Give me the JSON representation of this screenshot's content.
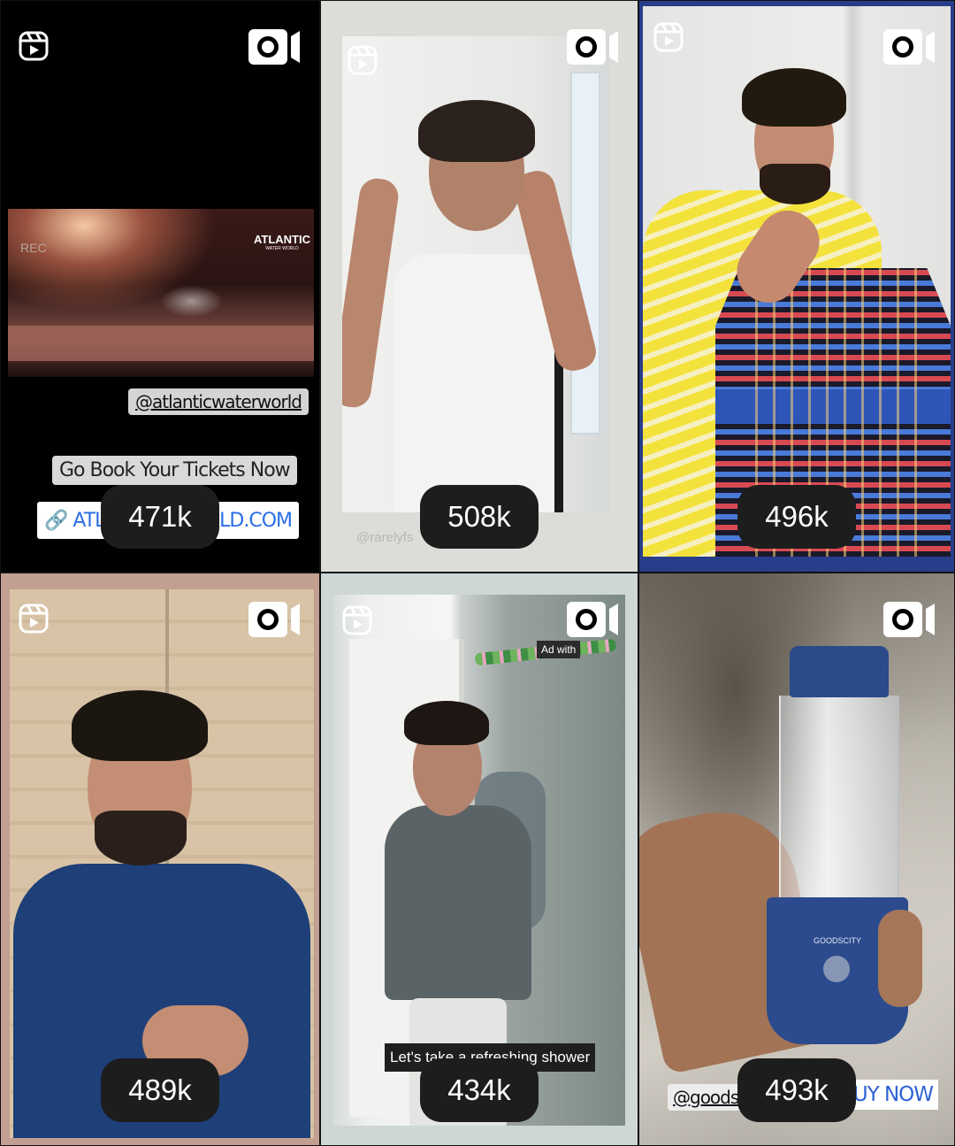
{
  "grid": {
    "tiles": [
      {
        "views": "471k",
        "overlay": {
          "rec_label": "REC",
          "brand": "ATLANTIC",
          "brand_sub": "WATER WORLD",
          "handle": "@atlanticwaterworld",
          "cta": "Go Book Your Tickets Now",
          "link_left": "ATL",
          "link_right": "RLD.COM"
        }
      },
      {
        "views": "508k",
        "overlay": {
          "watermark": "@rarelyfs"
        }
      },
      {
        "views": "496k"
      },
      {
        "views": "489k"
      },
      {
        "views": "434k",
        "overlay": {
          "ad_tag": "Ad with",
          "caption": "Let's take a refreshing shower"
        }
      },
      {
        "views": "493k",
        "overlay": {
          "brand": "GOODSCITY",
          "handle": "@goods",
          "cta": "BUY NOW"
        }
      }
    ]
  },
  "icons": {
    "reels": "reels-icon",
    "camera": "camera-icon",
    "link": "link-icon"
  },
  "colors": {
    "count_pill_bg": "#1d1d1d",
    "link_blue": "#2b6ee6"
  }
}
